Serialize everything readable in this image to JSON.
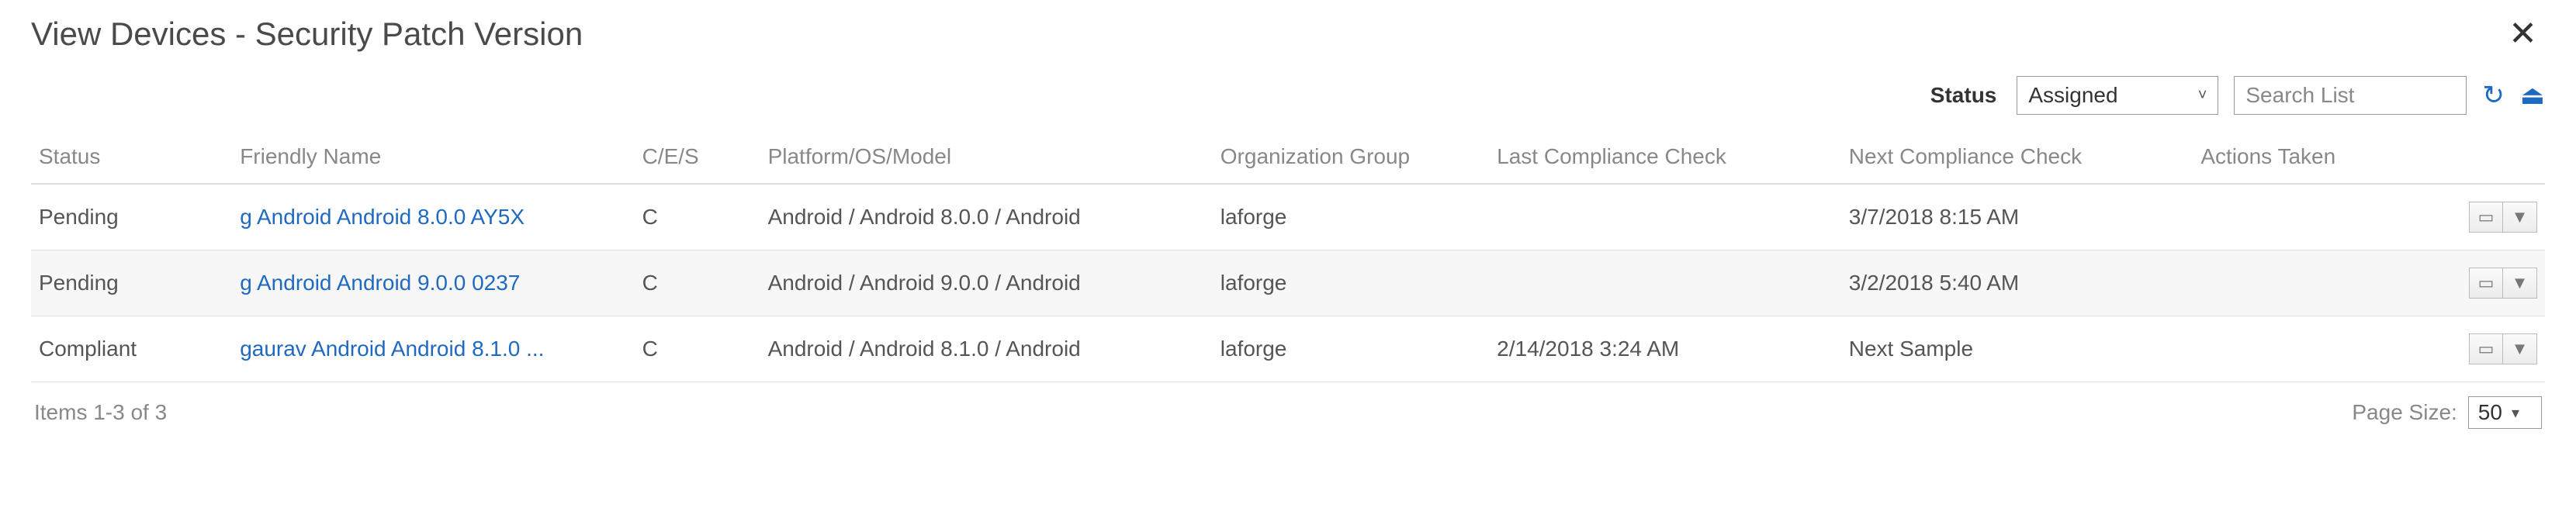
{
  "header": {
    "title": "View Devices - Security Patch Version"
  },
  "toolbar": {
    "status_label": "Status",
    "status_selected": "Assigned",
    "search_placeholder": "Search List"
  },
  "table": {
    "columns": {
      "status": "Status",
      "friendly_name": "Friendly Name",
      "ces": "C/E/S",
      "platform": "Platform/OS/Model",
      "org_group": "Organization Group",
      "last_check": "Last Compliance Check",
      "next_check": "Next Compliance Check",
      "actions": "Actions Taken"
    },
    "rows": [
      {
        "status": "Pending",
        "friendly_name": "g Android Android 8.0.0 AY5X",
        "ces": "C",
        "platform": "Android / Android 8.0.0 / Android",
        "org_group": "laforge",
        "last_check": "",
        "next_check": "3/7/2018 8:15 AM"
      },
      {
        "status": "Pending",
        "friendly_name": "g Android Android 9.0.0 0237",
        "ces": "C",
        "platform": "Android / Android 9.0.0 / Android",
        "org_group": "laforge",
        "last_check": "",
        "next_check": "3/2/2018 5:40 AM"
      },
      {
        "status": "Compliant",
        "friendly_name": "gaurav Android Android 8.1.0 ...",
        "ces": "C",
        "platform": "Android / Android 8.1.0 / Android",
        "org_group": "laforge",
        "last_check": "2/14/2018 3:24 AM",
        "next_check": "Next Sample"
      }
    ]
  },
  "footer": {
    "items_text": "Items 1-3 of 3",
    "page_size_label": "Page Size:",
    "page_size_value": "50"
  }
}
